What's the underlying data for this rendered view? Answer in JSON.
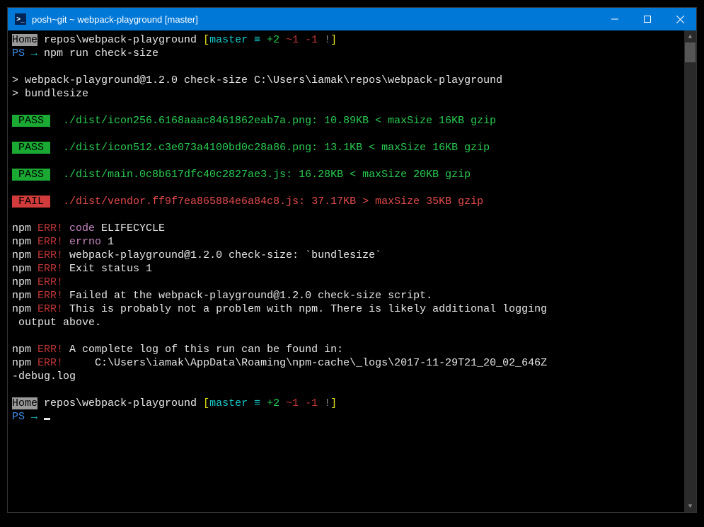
{
  "titlebar": {
    "title": "posh~git ~ webpack-playground [master]"
  },
  "prompt1": {
    "home": "Home",
    "path": " repos\\webpack-playground ",
    "lb": "[",
    "branch": "master",
    "eq": " ≡",
    "ahead": " +2",
    "tilde": " ~1",
    "behind": " -1",
    "bang": " !",
    "rb": "]"
  },
  "ps_line1": {
    "ps": "PS",
    "arrow": " → ",
    "cmd": "npm run check-size"
  },
  "npm_header": {
    "line1": "> webpack-playground@1.2.0 check-size C:\\Users\\iamak\\repos\\webpack-playground",
    "line2": "> bundlesize"
  },
  "results": {
    "pass_label": " PASS ",
    "fail_label": " FAIL ",
    "r1": "  ./dist/icon256.6168aaac8461862eab7a.png: 10.89KB < maxSize 16KB gzip",
    "r2": "  ./dist/icon512.c3e073a4100bd0c28a86.png: 13.1KB < maxSize 16KB gzip",
    "r3": "  ./dist/main.0c8b617dfc40c2827ae3.js: 16.28KB < maxSize 20KB gzip",
    "r4": "  ./dist/vendor.ff9f7ea865884e6a84c8.js: 37.17KB > maxSize 35KB gzip"
  },
  "errors": {
    "npm": "npm",
    "err": " ERR!",
    "code_label": " code",
    "code_val": " ELIFECYCLE",
    "errno_label": " errno",
    "errno_val": " 1",
    "l3": " webpack-playground@1.2.0 check-size: `bundlesize`",
    "l4": " Exit status 1",
    "l6": " Failed at the webpack-playground@1.2.0 check-size script.",
    "l7a": " This is probably not a problem with npm. There is likely additional logging",
    "l7b": " output above.",
    "l9": " A complete log of this run can be found in:",
    "l10a": "     C:\\Users\\iamak\\AppData\\Roaming\\npm-cache\\_logs\\2017-11-29T21_20_02_646Z",
    "l10b": "-debug.log"
  },
  "ps_line2": {
    "ps": "PS",
    "arrow": " → "
  }
}
